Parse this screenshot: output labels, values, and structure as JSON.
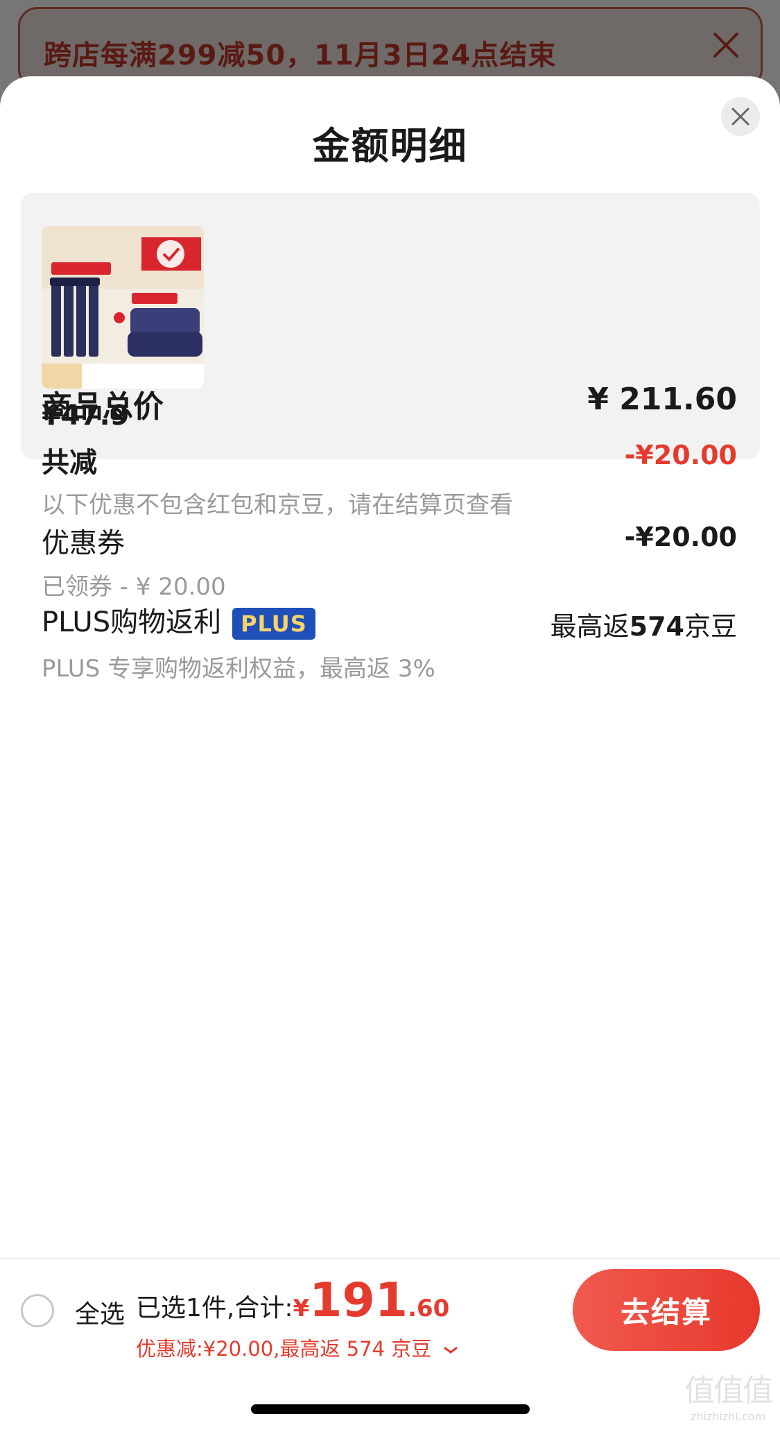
{
  "banner": {
    "text": "跨店每满299减50，11月3日24点结束"
  },
  "sheet": {
    "title": "金额明细"
  },
  "product": {
    "price": "¥47.9"
  },
  "details": {
    "total": {
      "label": "商品总价",
      "value": "¥ 211.60"
    },
    "discount": {
      "label": "共减",
      "value": "-¥20.00",
      "note": "以下优惠不包含红包和京豆，请在结算页查看"
    },
    "coupon": {
      "label": "优惠券",
      "value": "-¥20.00",
      "note": "已领券 - ¥ 20.00"
    },
    "plus": {
      "label": "PLUS购物返利",
      "badge": "PLUS",
      "value_prefix": "最高返",
      "value_amount": "574",
      "value_suffix": "京豆",
      "note": "PLUS 专享购物返利权益，最高返 3%"
    }
  },
  "checkout": {
    "select_all": "全选",
    "summary_label": "已选1件,合计:",
    "currency": "¥",
    "total_integer": "191",
    "total_decimal": ".60",
    "discount_summary": "优惠减:¥20.00,最高返 574 京豆",
    "button": "去结算"
  },
  "watermark": "zhizhizhi.com",
  "colors": {
    "accent_red": "#e43b2e",
    "plus_blue": "#1f4fb8",
    "plus_gold": "#f6d36b"
  },
  "icons": [
    "close-icon",
    "chevron-down-icon"
  ]
}
